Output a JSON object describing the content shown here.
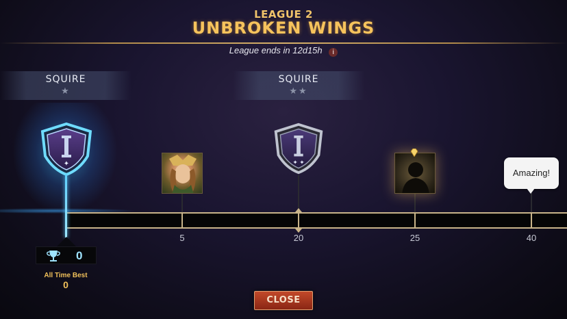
{
  "header": {
    "league_label": "LEAGUE 2",
    "league_name": "UNBROKEN WINGS",
    "ends_text": "League ends in 12d15h",
    "info_icon": "i"
  },
  "ranks": [
    {
      "name": "SQUIRE",
      "stars": "★"
    },
    {
      "name": "SQUIRE",
      "stars": "★★"
    }
  ],
  "track": {
    "ticks": [
      "5",
      "20",
      "25",
      "40"
    ]
  },
  "speech_bubble": {
    "text": "Amazing!"
  },
  "score": {
    "current": "0",
    "all_time_best_label": "All Time Best",
    "all_time_best_value": "0"
  },
  "close_button": {
    "label": "CLOSE"
  },
  "colors": {
    "gold": "#f6c35c",
    "glow_blue": "#5fd0ff",
    "close_red": "#b23a20"
  }
}
